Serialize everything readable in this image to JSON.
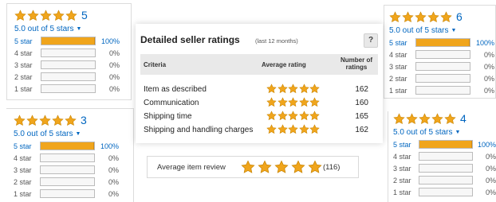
{
  "colors": {
    "link": "#0066c0",
    "bar_fill": "#f0a51c",
    "star": "#f0a51c"
  },
  "widgets": [
    {
      "id": "tl",
      "count": "5",
      "summary": "5.0 out of 5 stars",
      "rows": [
        {
          "label": "5 star",
          "pct": "100%",
          "fill": 1.0
        },
        {
          "label": "4 star",
          "pct": "0%",
          "fill": 0
        },
        {
          "label": "3 star",
          "pct": "0%",
          "fill": 0
        },
        {
          "label": "2 star",
          "pct": "0%",
          "fill": 0
        },
        {
          "label": "1 star",
          "pct": "0%",
          "fill": 0
        }
      ]
    },
    {
      "id": "bl",
      "count": "3",
      "summary": "5.0 out of 5 stars",
      "rows": [
        {
          "label": "5 star",
          "pct": "100%",
          "fill": 1.0
        },
        {
          "label": "4 star",
          "pct": "0%",
          "fill": 0
        },
        {
          "label": "3 star",
          "pct": "0%",
          "fill": 0
        },
        {
          "label": "2 star",
          "pct": "0%",
          "fill": 0
        },
        {
          "label": "1 star",
          "pct": "0%",
          "fill": 0
        }
      ]
    },
    {
      "id": "tr",
      "count": "6",
      "summary": "5.0 out of 5 stars",
      "rows": [
        {
          "label": "5 star",
          "pct": "100%",
          "fill": 1.0
        },
        {
          "label": "4 star",
          "pct": "0%",
          "fill": 0
        },
        {
          "label": "3 star",
          "pct": "0%",
          "fill": 0
        },
        {
          "label": "2 star",
          "pct": "0%",
          "fill": 0
        },
        {
          "label": "1 star",
          "pct": "0%",
          "fill": 0
        }
      ]
    },
    {
      "id": "br",
      "count": "4",
      "summary": "5.0 out of 5 stars",
      "rows": [
        {
          "label": "5 star",
          "pct": "100%",
          "fill": 1.0
        },
        {
          "label": "4 star",
          "pct": "0%",
          "fill": 0
        },
        {
          "label": "3 star",
          "pct": "0%",
          "fill": 0
        },
        {
          "label": "2 star",
          "pct": "0%",
          "fill": 0
        },
        {
          "label": "1 star",
          "pct": "0%",
          "fill": 0
        }
      ]
    }
  ],
  "seller": {
    "title": "Detailed seller ratings",
    "subtitle": "(last 12 months)",
    "help": "?",
    "headers": {
      "criteria": "Criteria",
      "average": "Average rating",
      "number_line1": "Number of",
      "number_line2": "ratings"
    },
    "rows": [
      {
        "criteria": "Item as described",
        "stars": 5,
        "count": "162"
      },
      {
        "criteria": "Communication",
        "stars": 5,
        "count": "160"
      },
      {
        "criteria": "Shipping time",
        "stars": 5,
        "count": "165"
      },
      {
        "criteria": "Shipping and handling charges",
        "stars": 5,
        "count": "162"
      }
    ],
    "average_review": {
      "label": "Average item review",
      "stars": 5,
      "count": "(116)"
    }
  }
}
